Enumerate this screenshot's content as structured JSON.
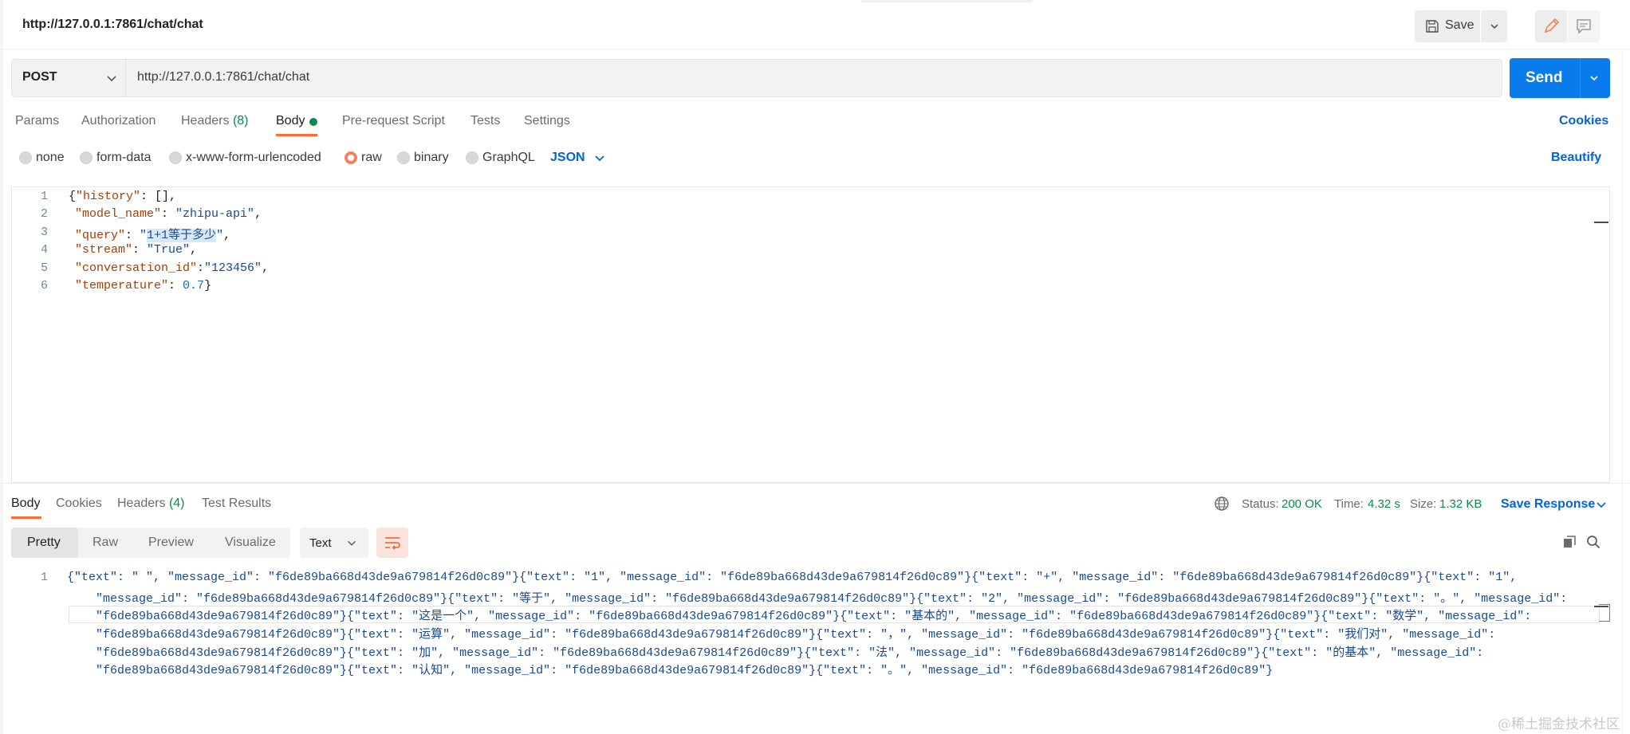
{
  "header": {
    "title": "http://127.0.0.1:7861/chat/chat",
    "save_label": "Save"
  },
  "request": {
    "method": "POST",
    "url": "http://127.0.0.1:7861/chat/chat",
    "send_label": "Send",
    "tabs": [
      {
        "label": "Params"
      },
      {
        "label": "Authorization"
      },
      {
        "label": "Headers",
        "count": "(8)"
      },
      {
        "label": "Body"
      },
      {
        "label": "Pre-request Script"
      },
      {
        "label": "Tests"
      },
      {
        "label": "Settings"
      }
    ],
    "cookies_label": "Cookies",
    "body_types": [
      "none",
      "form-data",
      "x-www-form-urlencoded",
      "raw",
      "binary",
      "GraphQL"
    ],
    "selected_body_type": "raw",
    "format": "JSON",
    "beautify_label": "Beautify",
    "line_numbers": [
      "1",
      "2",
      "3",
      "4",
      "5",
      "6"
    ],
    "code": {
      "l1_open": "{",
      "l1_key": "\"history\"",
      "l1_rest": ": [],",
      "l2_key": "\"model_name\"",
      "l2_sep": ": ",
      "l2_val": "\"zhipu-api\"",
      "l2_end": ",",
      "l3_key": "\"query\"",
      "l3_sep": ": ",
      "l3_q1": "\"",
      "l3_val": "1+1等于多少",
      "l3_q2": "\"",
      "l3_end": ",",
      "l4_key": "\"stream\"",
      "l4_sep": ": ",
      "l4_val": "\"True\"",
      "l4_end": ",",
      "l5_key": "\"conversation_id\"",
      "l5_sep": ":",
      "l5_val": "\"123456\"",
      "l5_end": ",",
      "l6_key": "\"temperature\"",
      "l6_sep": ": ",
      "l6_val": "0.7",
      "l6_end": "}"
    }
  },
  "response": {
    "tabs": [
      {
        "label": "Body"
      },
      {
        "label": "Cookies"
      },
      {
        "label": "Headers",
        "count": "(4)"
      },
      {
        "label": "Test Results"
      }
    ],
    "status_label": "Status:",
    "status_value": "200 OK",
    "time_label": "Time:",
    "time_value": "4.32 s",
    "size_label": "Size:",
    "size_value": "1.32 KB",
    "save_response_label": "Save Response",
    "views": [
      "Pretty",
      "Raw",
      "Preview",
      "Visualize"
    ],
    "format": "Text",
    "line_number": "1",
    "lines": [
      "{\"text\": \" \", \"message_id\": \"f6de89ba668d43de9a679814f26d0c89\"}{\"text\": \"1\", \"message_id\": \"f6de89ba668d43de9a679814f26d0c89\"}{\"text\": \"+\", \"message_id\": \"f6de89ba668d43de9a679814f26d0c89\"}{\"text\": \"1\",",
      "\"message_id\": \"f6de89ba668d43de9a679814f26d0c89\"}{\"text\": \"等于\", \"message_id\": \"f6de89ba668d43de9a679814f26d0c89\"}{\"text\": \"2\", \"message_id\": \"f6de89ba668d43de9a679814f26d0c89\"}{\"text\": \"。\", \"message_id\":",
      "\"f6de89ba668d43de9a679814f26d0c89\"}{\"text\": \"这是一个\", \"message_id\": \"f6de89ba668d43de9a679814f26d0c89\"}{\"text\": \"基本的\", \"message_id\": \"f6de89ba668d43de9a679814f26d0c89\"}{\"text\": \"数学\", \"message_id\":",
      "\"f6de89ba668d43de9a679814f26d0c89\"}{\"text\": \"运算\", \"message_id\": \"f6de89ba668d43de9a679814f26d0c89\"}{\"text\": \"，\", \"message_id\": \"f6de89ba668d43de9a679814f26d0c89\"}{\"text\": \"我们对\", \"message_id\":",
      "\"f6de89ba668d43de9a679814f26d0c89\"}{\"text\": \"加\", \"message_id\": \"f6de89ba668d43de9a679814f26d0c89\"}{\"text\": \"法\", \"message_id\": \"f6de89ba668d43de9a679814f26d0c89\"}{\"text\": \"的基本\", \"message_id\":",
      "\"f6de89ba668d43de9a679814f26d0c89\"}{\"text\": \"认知\", \"message_id\": \"f6de89ba668d43de9a679814f26d0c89\"}{\"text\": \"。\", \"message_id\": \"f6de89ba668d43de9a679814f26d0c89\"}"
    ]
  },
  "watermark": "@稀土掘金技术社区",
  "colors": {
    "accent_blue": "#097bed",
    "link_blue": "#0265d2",
    "active_orange": "#ff6c37",
    "status_green": "#0c8c4a"
  },
  "icons": [
    "save-icon",
    "chevron-down-icon",
    "pencil-icon",
    "comment-icon",
    "globe-icon",
    "wrap-lines-icon",
    "copy-icon",
    "search-icon"
  ]
}
